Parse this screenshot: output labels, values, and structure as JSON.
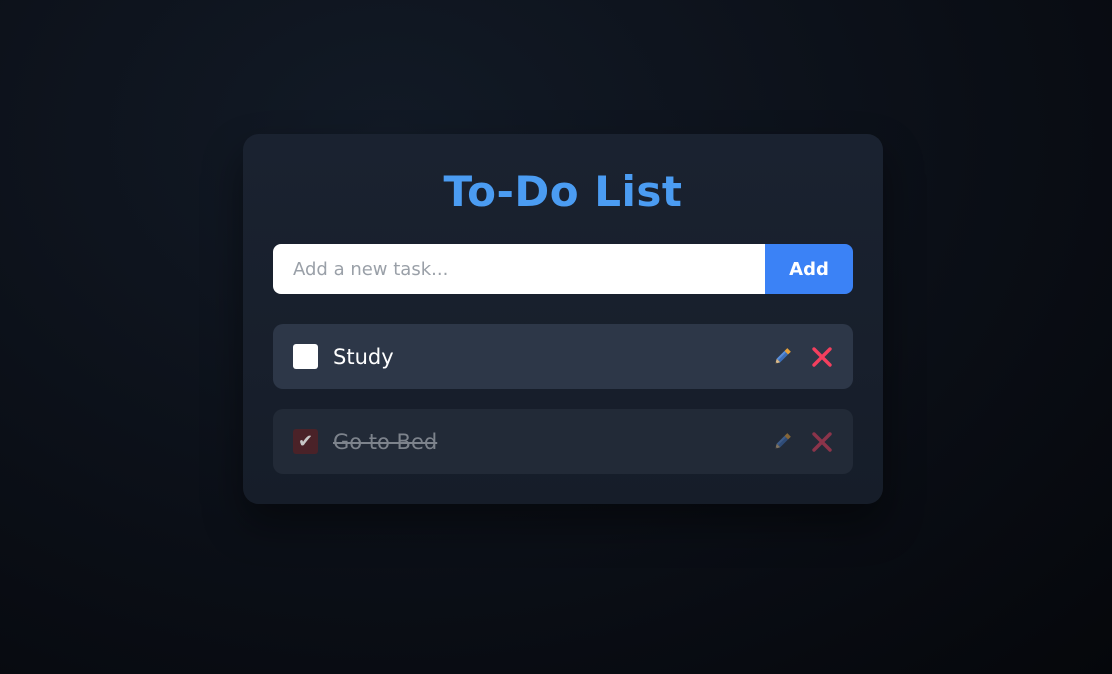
{
  "app": {
    "title": "To-Do List"
  },
  "new_task": {
    "placeholder": "Add a new task...",
    "value": "",
    "add_label": "Add"
  },
  "tasks": [
    {
      "text": "Study",
      "completed": false,
      "edit_icon": "pencil-icon",
      "delete_icon": "close-icon"
    },
    {
      "text": "Go to Bed",
      "completed": true,
      "edit_icon": "pencil-icon",
      "delete_icon": "close-icon"
    }
  ],
  "colors": {
    "accent": "#4b9cf2",
    "add_button": "#3b82f6",
    "delete": "#f43f5e",
    "task_bg": "#2d3748"
  }
}
